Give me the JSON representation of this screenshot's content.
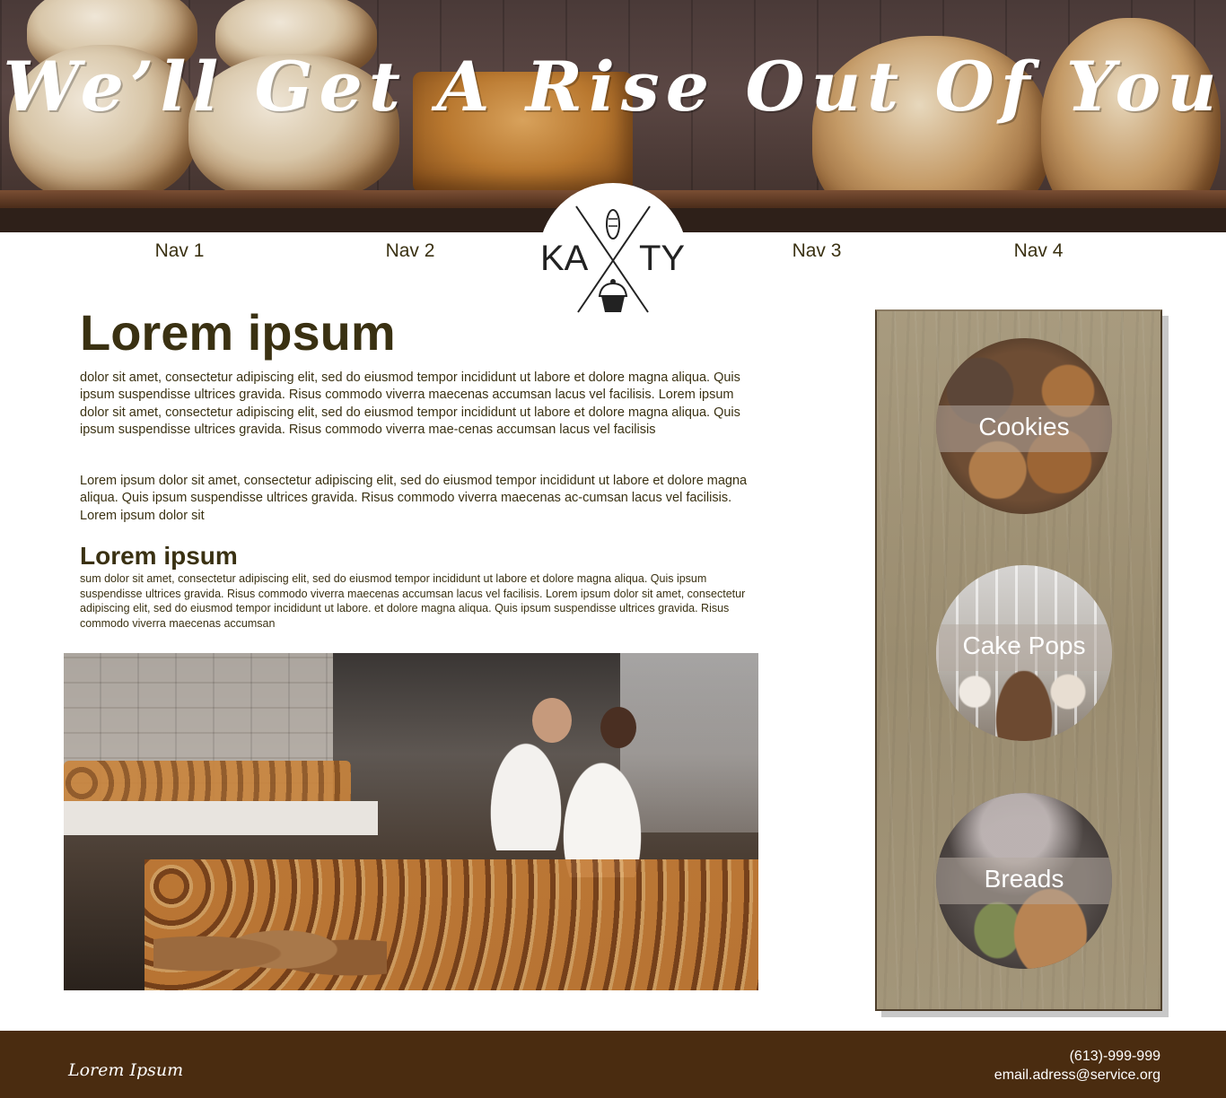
{
  "hero": {
    "title": "We’ll Get A Rise Out Of You"
  },
  "nav": {
    "items": [
      "Nav 1",
      "Nav 2",
      "Nav 3",
      "Nav 4"
    ]
  },
  "logo": {
    "left_text": "KA",
    "right_text": "TY"
  },
  "main": {
    "heading": "Lorem ipsum",
    "paragraph1": "dolor sit amet, consectetur adipiscing elit, sed do eiusmod tempor incididunt ut labore et dolore magna aliqua. Quis ipsum suspendisse ultrices gravida. Risus commodo viverra maecenas accumsan lacus vel facilisis. Lorem ipsum dolor sit amet, consectetur adipiscing elit, sed do eiusmod tempor incididunt ut labore et dolore magna aliqua. Quis ipsum suspendisse ultrices gravida. Risus commodo viverra mae-cenas accumsan lacus vel facilisis",
    "paragraph2": "Lorem ipsum dolor sit amet, consectetur adipiscing elit, sed do eiusmod tempor incididunt ut labore et dolore magna aliqua. Quis ipsum suspendisse ultrices gravida. Risus commodo viverra maecenas ac-cumsan lacus vel facilisis. Lorem ipsum dolor sit",
    "subheading": "Lorem ipsum",
    "paragraph3": "sum dolor sit amet, consectetur adipiscing elit, sed do eiusmod tempor incididunt ut labore et dolore magna aliqua. Quis ipsum suspendisse ultrices gravida. Risus commodo viverra maecenas accumsan lacus vel facilisis. Lorem ipsum dolor sit amet, consectetur adipiscing elit, sed do eiusmod tempor incididunt ut labore. et dolore magna aliqua. Quis ipsum suspendisse ultrices gravida. Risus commodo viverra maecenas accumsan"
  },
  "sidebar": {
    "categories": [
      "Cookies",
      "Cake Pops",
      "Breads"
    ]
  },
  "footer": {
    "brand": "Lorem Ipsum",
    "phone": "(613)-999-999",
    "email": "email.adress@service.org"
  }
}
